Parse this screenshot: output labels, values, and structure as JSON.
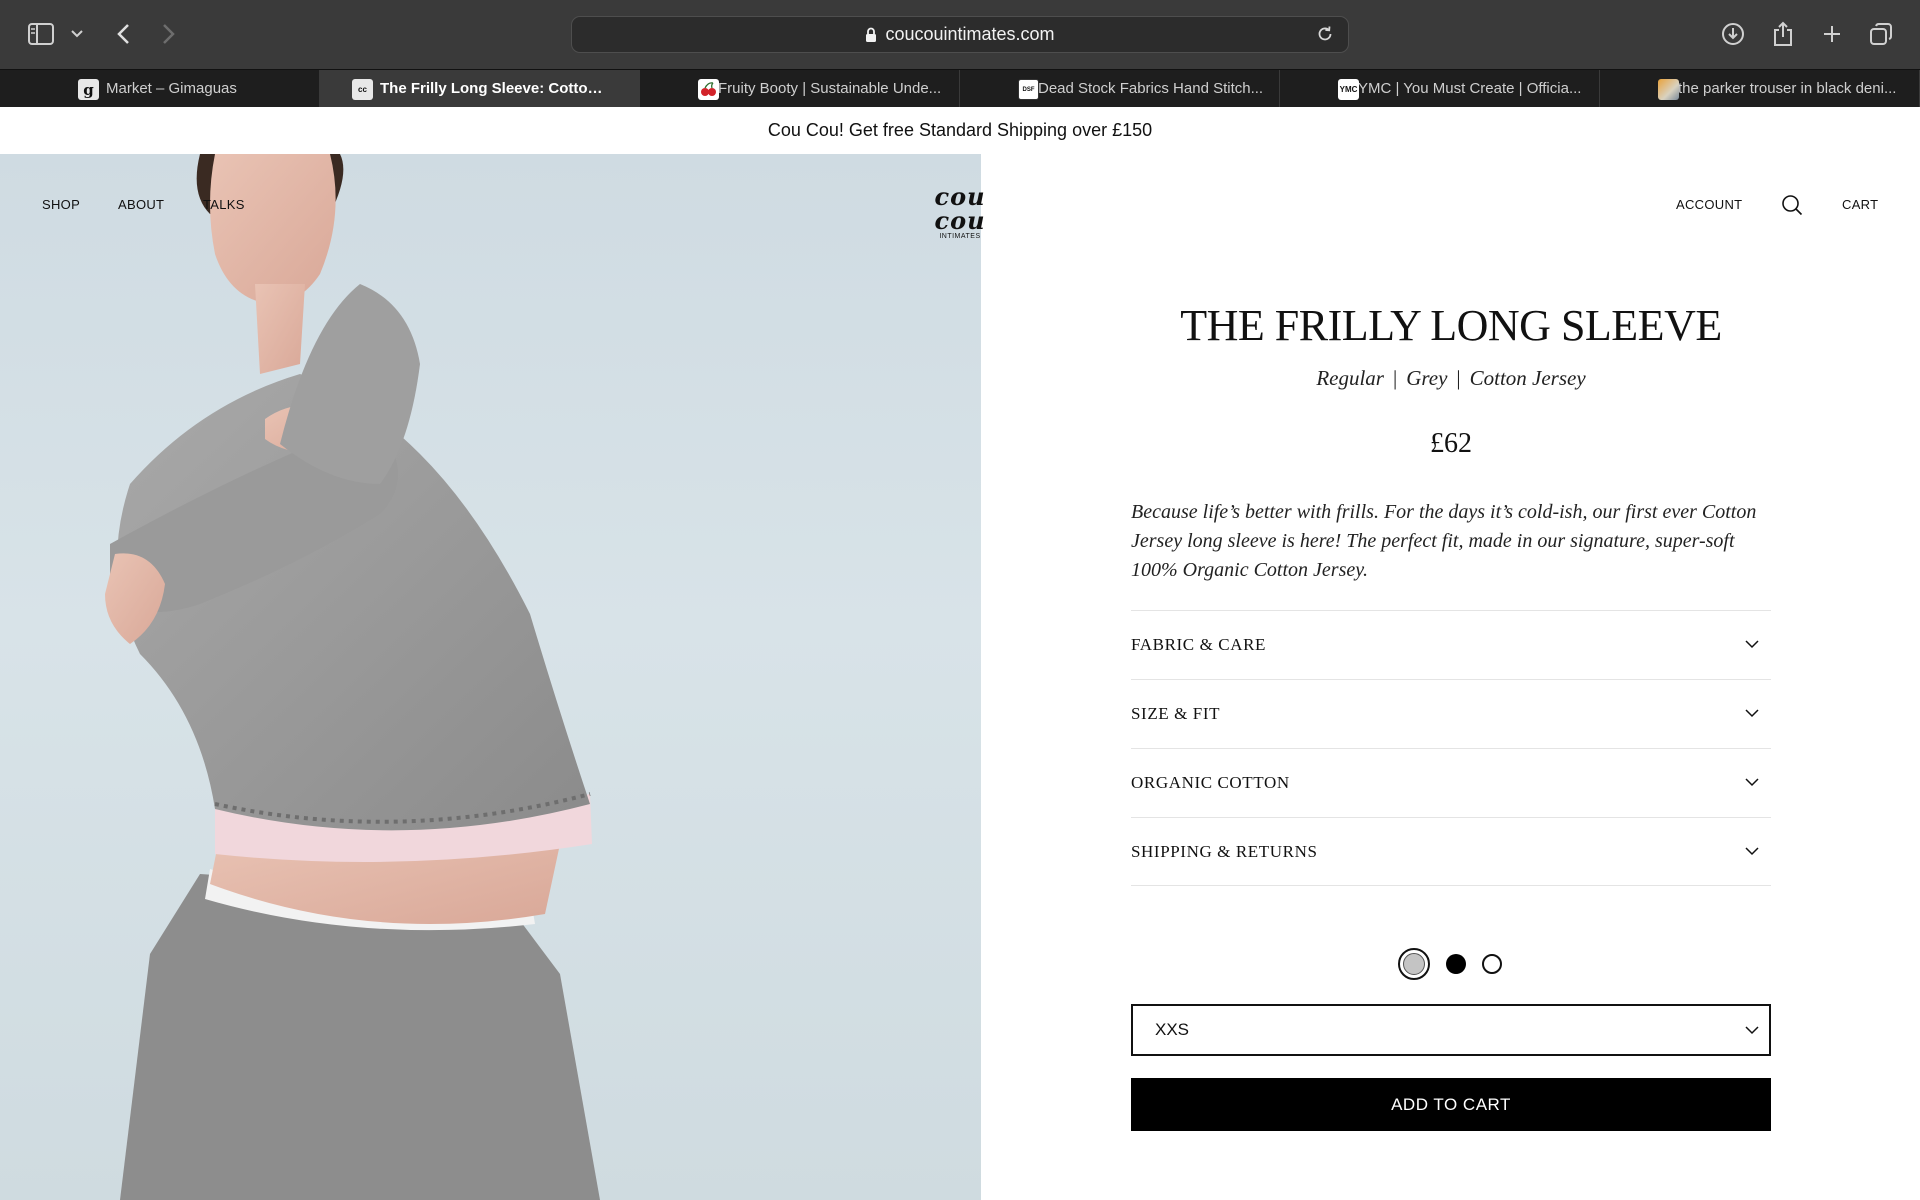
{
  "browser": {
    "url": "coucouintimates.com",
    "tabs": [
      {
        "label": "Market – Gimaguas",
        "favicon": "g",
        "active": false
      },
      {
        "label": "The Frilly Long Sleeve: Cotton J...",
        "favicon": "cc",
        "active": true
      },
      {
        "label": "Fruity Booty | Sustainable Unde...",
        "favicon": "cherry",
        "active": false
      },
      {
        "label": "Dead Stock Fabrics Hand Stitch...",
        "favicon": "dsf",
        "active": false
      },
      {
        "label": "YMC | You Must Create | Officia...",
        "favicon": "YMC",
        "active": false
      },
      {
        "label": "the parker trouser in black deni...",
        "favicon": "img",
        "active": false
      }
    ],
    "toolbar_icons": [
      "sidebar-icon",
      "chevron-down-icon",
      "back-icon",
      "forward-icon",
      "lock-icon",
      "reload-icon",
      "download-icon",
      "share-icon",
      "new-tab-icon",
      "tabs-overview-icon"
    ]
  },
  "announcement": "Cou Cou! Get free Standard Shipping over £150",
  "site_nav": {
    "left": [
      "SHOP",
      "ABOUT",
      "TALKS"
    ],
    "logo": "cou cou",
    "logo_sub": "INTIMATES",
    "account": "ACCOUNT",
    "cart": "CART"
  },
  "product": {
    "title": "THE FRILLY LONG SLEEVE",
    "fit": "Regular",
    "color": "Grey",
    "fabric": "Cotton Jersey",
    "separator": "|",
    "price": "£62",
    "description": "Because life’s better with frills. For the days it’s cold-ish, our first ever Cotton Jersey long sleeve is here! The perfect fit, made in our signature, super-soft 100% Organic Cotton Jersey.",
    "accordion": [
      "FABRIC & CARE",
      "SIZE & FIT",
      "ORGANIC COTTON",
      "SHIPPING & RETURNS"
    ],
    "swatches": [
      {
        "name": "grey",
        "color": "#c4c4c4",
        "selected": true
      },
      {
        "name": "black",
        "color": "#000000",
        "selected": false
      },
      {
        "name": "white",
        "color": "#ffffff",
        "selected": false
      }
    ],
    "size_selected": "XXS",
    "add_to_cart": "ADD TO CART"
  },
  "colors": {
    "toolbar": "#3a3a3a",
    "tabbar": "#1e1e1e",
    "button": "#000000",
    "hero_background": "#d3dfe5"
  }
}
